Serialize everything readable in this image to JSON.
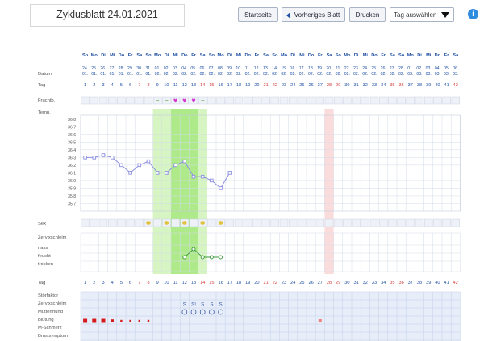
{
  "header": {
    "title": "Zyklusblatt 24.01.2021",
    "start_label": "Startseite",
    "prev_label": "Vorheriges Blatt",
    "print_label": "Drucken",
    "select_value": "Tag auswählen",
    "info_label": "i"
  },
  "rows": {
    "datum": "Datum",
    "tag": "Tag",
    "fruchtb": "Fruchtb.",
    "temp": "Temp.",
    "sex": "Sex",
    "zervix": "Zervixschleim",
    "zervix_nass": "nass",
    "zervix_feucht": "feucht",
    "zervix_trocken": "trocken",
    "tag2": "Tag",
    "stoerfaktor": "Störfaktor",
    "zervixschleim2": "Zervixschleim",
    "muttermund": "Muttermund",
    "blutung": "Blutung",
    "mschmerz": "M-Schmerz",
    "brustsymptom": "Brustsymptom"
  },
  "weekdays": [
    "So",
    "Mo",
    "Di",
    "Mi",
    "Do",
    "Fr",
    "Sa",
    "So",
    "Mo",
    "Di",
    "Mi",
    "Do",
    "Fr",
    "Sa",
    "So",
    "Mo",
    "Di",
    "Mi",
    "Do",
    "Fr",
    "Sa",
    "So",
    "Mo",
    "Di",
    "Mi",
    "Do",
    "Fr",
    "Sa",
    "So",
    "Mo",
    "Di",
    "Mi",
    "Do",
    "Fr",
    "Sa",
    "So",
    "Mo",
    "Di",
    "Mi",
    "Do",
    "Fr",
    "Sa"
  ],
  "dates_day": [
    "24.",
    "25.",
    "26.",
    "27.",
    "28.",
    "29.",
    "30.",
    "31.",
    "01.",
    "02.",
    "03.",
    "04.",
    "05.",
    "06.",
    "07.",
    "08.",
    "09.",
    "10.",
    "11.",
    "12.",
    "13.",
    "14.",
    "15.",
    "16.",
    "17.",
    "18.",
    "19.",
    "20.",
    "21.",
    "22.",
    "23.",
    "24.",
    "25.",
    "26.",
    "27.",
    "28.",
    "01.",
    "02.",
    "03.",
    "04.",
    "05.",
    "06."
  ],
  "dates_month": [
    "01.",
    "01.",
    "01.",
    "01.",
    "01.",
    "01.",
    "01.",
    "01.",
    "02.",
    "02.",
    "02.",
    "02.",
    "02.",
    "02.",
    "02.",
    "02.",
    "02.",
    "02.",
    "02.",
    "02.",
    "02.",
    "02.",
    "02.",
    "02.",
    "02.",
    "02.",
    "02.",
    "02.",
    "02.",
    "02.",
    "02.",
    "02.",
    "02.",
    "02.",
    "02.",
    "02.",
    "03.",
    "03.",
    "03.",
    "03.",
    "03.",
    "03."
  ],
  "cycle_days": [
    "1",
    "2",
    "3",
    "4",
    "5",
    "6",
    "7",
    "8",
    "9",
    "10",
    "11",
    "12",
    "13",
    "14",
    "15",
    "16",
    "17",
    "18",
    "19",
    "20",
    "21",
    "22",
    "23",
    "24",
    "25",
    "26",
    "27",
    "28",
    "29",
    "30",
    "31",
    "32",
    "33",
    "34",
    "35",
    "36",
    "37",
    "38",
    "39",
    "40",
    "41",
    "42"
  ],
  "temp_axis": [
    "36.8",
    "36.7",
    "36.6",
    "36.5",
    "36.4",
    "36.3",
    "36.2",
    "36.1",
    "36.0",
    "35.9",
    "35.8",
    "35.7"
  ],
  "temp_values": [
    {
      "day": 1,
      "t": 36.3
    },
    {
      "day": 2,
      "t": 36.3
    },
    {
      "day": 3,
      "t": 36.33
    },
    {
      "day": 4,
      "t": 36.3
    },
    {
      "day": 5,
      "t": 36.2
    },
    {
      "day": 6,
      "t": 36.1
    },
    {
      "day": 7,
      "t": 36.2
    },
    {
      "day": 8,
      "t": 36.25
    },
    {
      "day": 9,
      "t": 36.1
    },
    {
      "day": 10,
      "t": 36.1
    },
    {
      "day": 11,
      "t": 36.2
    },
    {
      "day": 12,
      "t": 36.25
    },
    {
      "day": 13,
      "t": 36.05
    },
    {
      "day": 14,
      "t": 36.05
    },
    {
      "day": 15,
      "t": 36.0
    },
    {
      "day": 16,
      "t": 35.9
    },
    {
      "day": 17,
      "t": 36.1
    }
  ],
  "fertile_marks": [
    {
      "day": 9,
      "symbol": "~"
    },
    {
      "day": 10,
      "symbol": "~"
    },
    {
      "day": 11,
      "symbol": "♥"
    },
    {
      "day": 12,
      "symbol": "♥"
    },
    {
      "day": 13,
      "symbol": "♥"
    },
    {
      "day": 14,
      "symbol": "~"
    }
  ],
  "sex_days": [
    8,
    10,
    12,
    14,
    16
  ],
  "zervix_points": [
    {
      "day": 12,
      "v": "feucht"
    },
    {
      "day": 13,
      "v": "nass"
    },
    {
      "day": 14,
      "v": "feucht"
    },
    {
      "day": 15,
      "v": "feucht"
    },
    {
      "day": 16,
      "v": "feucht"
    }
  ],
  "zervix_codes": [
    {
      "day": 12,
      "code": "S"
    },
    {
      "day": 13,
      "code": "S!"
    },
    {
      "day": 14,
      "code": "S"
    },
    {
      "day": 15,
      "code": "S"
    },
    {
      "day": 16,
      "code": "S"
    }
  ],
  "muttermund_days": [
    12,
    13,
    14,
    15,
    16
  ],
  "blutung": [
    {
      "day": 1,
      "size": "big"
    },
    {
      "day": 2,
      "size": "big"
    },
    {
      "day": 3,
      "size": "big"
    },
    {
      "day": 4,
      "size": "mid"
    },
    {
      "day": 5,
      "size": "small"
    },
    {
      "day": 6,
      "size": "small"
    },
    {
      "day": 7,
      "size": "small"
    },
    {
      "day": 8,
      "size": "small"
    },
    {
      "day": 27,
      "size": "marker"
    }
  ],
  "weekend_days": [
    7,
    8,
    14,
    15,
    21,
    22,
    28,
    29,
    35,
    36,
    42
  ],
  "green_band": {
    "start": 9,
    "end": 14
  },
  "green_core": {
    "start": 11,
    "end": 13
  },
  "red_band_day": 28,
  "colors": {
    "accent": "#1f4fa3",
    "grid": "#d3dbe8",
    "weekend": "#d23b3b",
    "green_light": "#d7f5c2",
    "green": "#aeea8a",
    "red_band": "#fbdcdc",
    "line": "#8c8fe0",
    "heart": "#d23bd0"
  }
}
